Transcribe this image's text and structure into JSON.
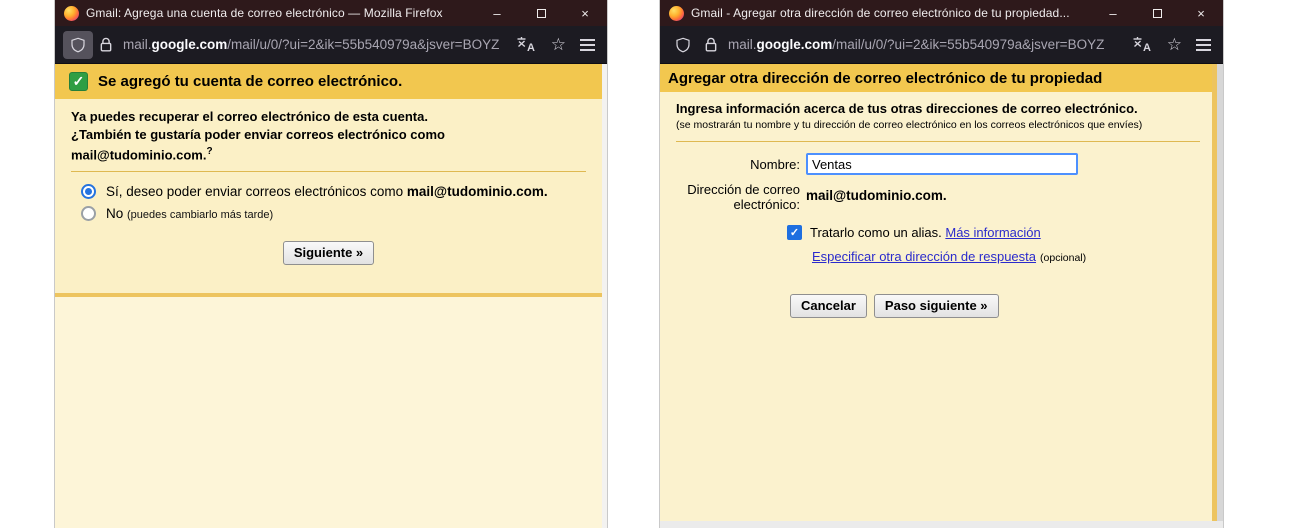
{
  "left": {
    "title": "Gmail: Agrega una cuenta de correo electrónico — Mozilla Firefox",
    "url": {
      "sub": "mail.",
      "domain": "google.com",
      "path": "/mail/u/0/?ui=2&ik=55b540979a&jsver=BOYZ"
    },
    "dialog": {
      "header": "Se agregó tu cuenta de correo electrónico.",
      "line1": "Ya puedes recuperar el correo electrónico de esta cuenta.",
      "line2": "¿También te gustaría poder enviar correos electrónico como",
      "email": "mail@tudominio.com.",
      "email_suffix": "?",
      "radio_yes_text": "Sí, deseo poder enviar correos electrónicos como ",
      "radio_yes_email": "mail@tudominio.com.",
      "radio_no_text": "No ",
      "radio_no_note": "(puedes cambiarlo más tarde)",
      "next_button": "Siguiente »"
    }
  },
  "right": {
    "title": "Gmail - Agregar otra dirección de correo electrónico de tu propiedad...",
    "url": {
      "sub": "mail.",
      "domain": "google.com",
      "path": "/mail/u/0/?ui=2&ik=55b540979a&jsver=BOYZ"
    },
    "dialog": {
      "header": "Agregar otra dirección de correo electrónico de tu propiedad",
      "intro": "Ingresa información acerca de tus otras direcciones de correo electrónico.",
      "note": "(se mostrarán tu nombre y tu dirección de correo electrónico en los correos electrónicos que envíes)",
      "name_label": "Nombre:",
      "name_value": "Ventas",
      "email_label": "Dirección de correo electrónico:",
      "email_value": "mail@tudominio.com.",
      "alias_label": "Tratarlo como un alias. ",
      "more_info_link": "Más información",
      "reply_link": "Especificar otra dirección de respuesta",
      "reply_note": "(opcional)",
      "cancel_button": "Cancelar",
      "next_button": "Paso siguiente »"
    }
  },
  "chrome": {
    "minimize": "–",
    "close": "×",
    "star": "☆",
    "check": "✓",
    "colors": {
      "titlebar": "#2e191b",
      "urlbar": "#1c1b22",
      "gold": "#f2c74f",
      "cream": "#fbf0c6",
      "link_blue": "#2b2bcc",
      "radio_blue": "#2573df",
      "focus_blue": "#4d90fe",
      "check_green": "#2f9e44"
    }
  }
}
